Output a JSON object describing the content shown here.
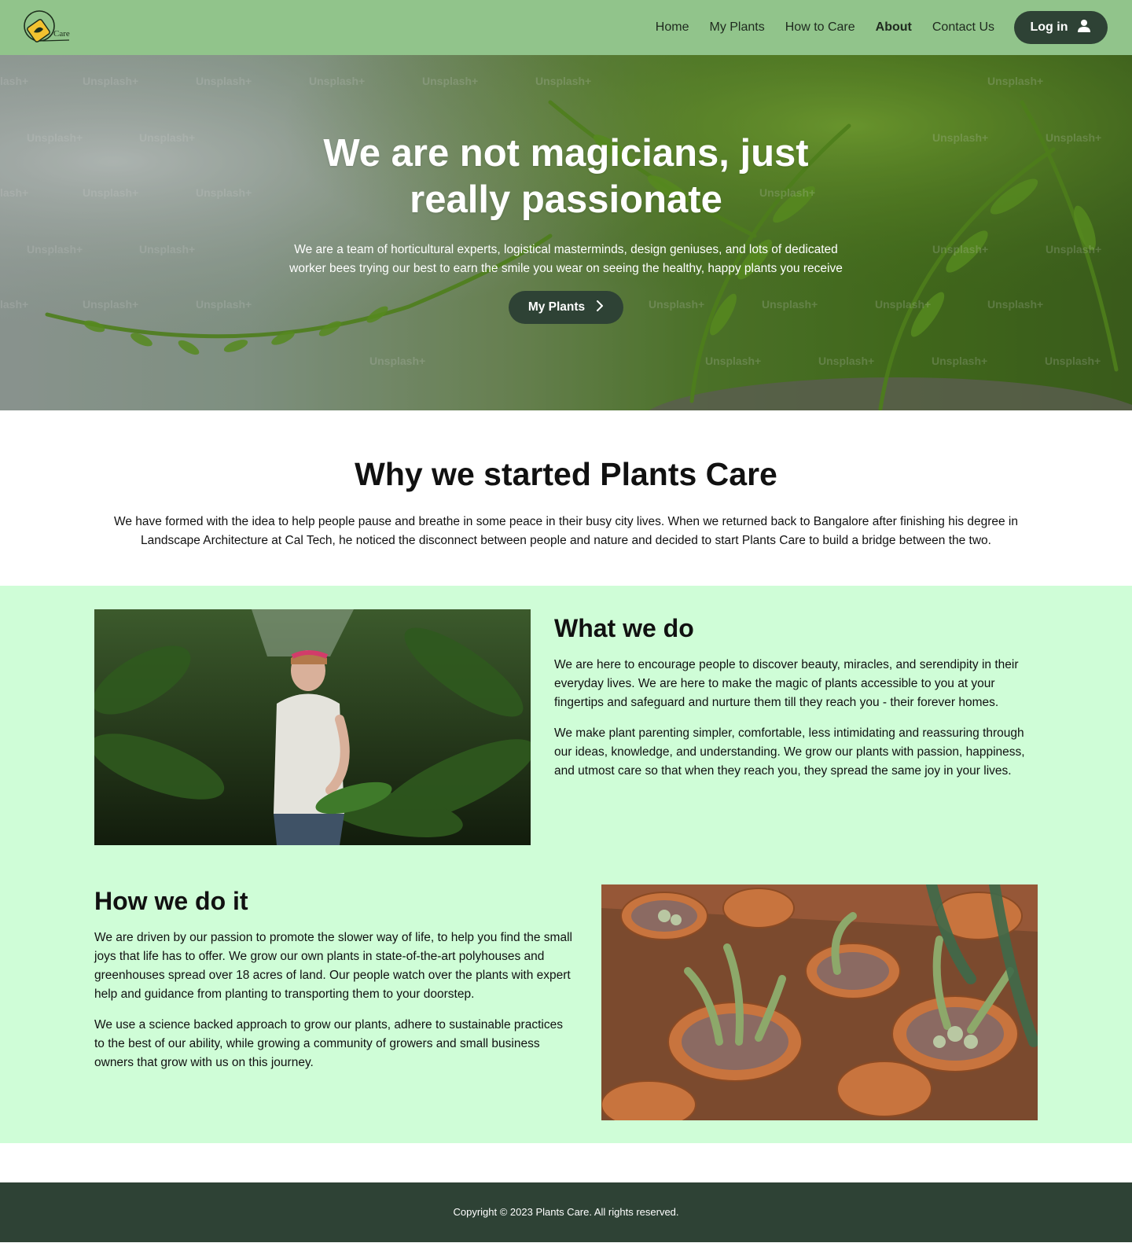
{
  "nav": {
    "logo_text": "Care",
    "links": [
      "Home",
      "My Plants",
      "How to Care",
      "About",
      "Contact Us"
    ],
    "active": "About",
    "login_label": "Log in"
  },
  "hero": {
    "title": "We are not magicians, just really passionate",
    "description": "We are a team of horticultural experts, logistical masterminds, design geniuses, and lots of dedicated worker bees trying our best to earn the smile you wear on seeing the healthy, happy plants you receive",
    "button_label": "My Plants",
    "watermark": "Unsplash+"
  },
  "why": {
    "title": "Why we started Plants Care",
    "text": "We have formed with the idea to help people pause and breathe in some peace in their busy city lives. When we returned back to Bangalore after finishing his degree in Landscape Architecture at Cal Tech, he noticed the disconnect between people and nature and decided to start Plants Care to build a bridge between the two."
  },
  "what": {
    "title": "What we do",
    "paragraphs": [
      "We are here to encourage people to discover beauty, miracles, and serendipity in their everyday lives. We are here to make the magic of plants accessible to you at your fingertips and safeguard and nurture them till they reach you - their forever homes.",
      "We make plant parenting simpler, comfortable, less intimidating and reassuring through our ideas, knowledge, and understanding. We grow our plants with passion, happiness, and utmost care so that when they reach you, they spread the same joy in your lives."
    ]
  },
  "how": {
    "title": "How we do it",
    "paragraphs": [
      "We are driven by our passion to promote the slower way of life, to help you find the small joys that life has to offer. We grow our own plants in state-of-the-art polyhouses and greenhouses spread over 18 acres of land. Our people watch over the plants with expert help and guidance from planting to transporting them to your doorstep.",
      "We use a science backed approach to grow our plants, adhere to sustainable practices to the best of our ability, while growing a community of growers and small business owners that grow with us on this journey."
    ]
  },
  "footer": {
    "copyright": "Copyright © 2023 Plants Care. All rights reserved."
  },
  "colors": {
    "navbar": "#91c48b",
    "dark": "#2e4235",
    "mint": "#cffdd7"
  }
}
